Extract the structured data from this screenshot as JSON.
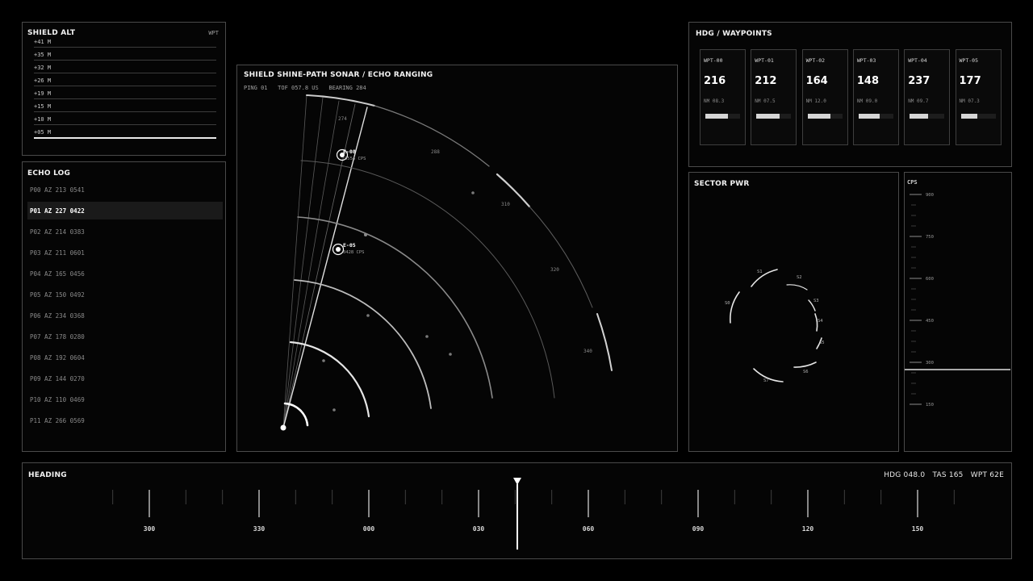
{
  "altitude": {
    "title": "SHIELD ALT",
    "mode": "WPT",
    "rows": [
      "+41 M",
      "+35 M",
      "+32 M",
      "+26 M",
      "+19 M",
      "+15 M",
      "+10 M",
      "+05 M"
    ],
    "active_index": 7
  },
  "echo_log": {
    "title": "ECHO LOG",
    "rows": [
      "P00 AZ 213 0541",
      "P01 AZ 227 0422",
      "P02 AZ 214 0383",
      "P03 AZ 211 0601",
      "P04 AZ 165 0456",
      "P05 AZ 150 0492",
      "P06 AZ 234 0368",
      "P07 AZ 178 0280",
      "P08 AZ 192 0604",
      "P09 AZ 144 0270",
      "P10 AZ 110 0469",
      "P11 AZ 266 0569"
    ],
    "active_index": 1
  },
  "sonar": {
    "title": "SHIELD SHINE-PATH SONAR / ECHO RANGING",
    "status": "PING 01   TOF 057.8 US   BEARING 284",
    "bearing_labels": [
      "274",
      "288",
      "310",
      "320",
      "340"
    ],
    "targets": [
      {
        "id": "E-08",
        "cps": "0554 CPS"
      },
      {
        "id": "E-05",
        "cps": "0428 CPS"
      }
    ]
  },
  "waypoints": {
    "title": "HDG / WAYPOINTS",
    "items": [
      {
        "id": "WPT-00",
        "hdg": "216",
        "nm": "NM 08.3",
        "level": 0.65
      },
      {
        "id": "WPT-01",
        "hdg": "212",
        "nm": "NM 07.5",
        "level": 0.67
      },
      {
        "id": "WPT-02",
        "hdg": "164",
        "nm": "NM 12.0",
        "level": 0.65
      },
      {
        "id": "WPT-03",
        "hdg": "148",
        "nm": "NM 09.0",
        "level": 0.6
      },
      {
        "id": "WPT-04",
        "hdg": "237",
        "nm": "NM 09.7",
        "level": 0.52
      },
      {
        "id": "WPT-05",
        "hdg": "177",
        "nm": "NM 07.3",
        "level": 0.48
      }
    ]
  },
  "sector_pwr": {
    "title": "SECTOR PWR",
    "sectors": [
      "S0",
      "S1",
      "S2",
      "S3",
      "S4",
      "S5",
      "S6",
      "S7"
    ]
  },
  "cps_scale": {
    "title": "CPS",
    "ticks": [
      "900",
      "750",
      "600",
      "450",
      "300",
      "150"
    ],
    "current": 300
  },
  "heading": {
    "title": "HEADING",
    "readout": "HDG 048.0   TAS 165   WPT 62E",
    "tick_labels": [
      "300",
      "330",
      "000",
      "030",
      "060",
      "090",
      "120",
      "150"
    ]
  }
}
